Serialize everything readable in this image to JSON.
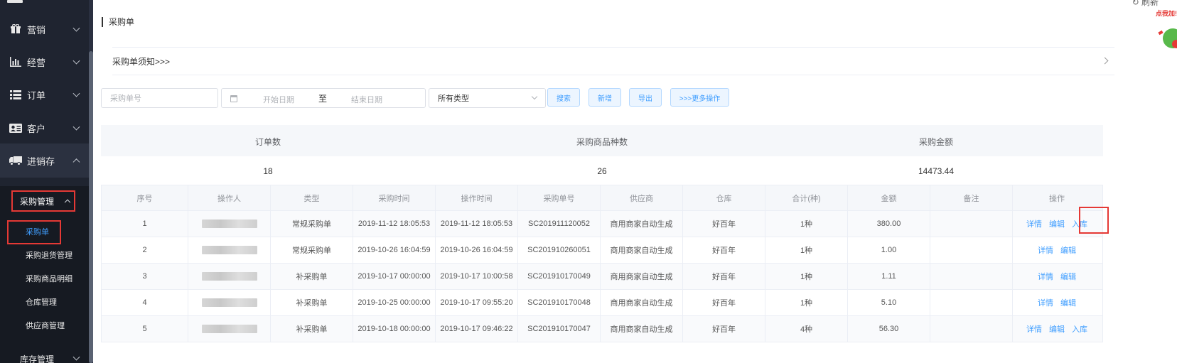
{
  "sidebar": {
    "items": [
      {
        "label": "营销",
        "icon": "gift-icon"
      },
      {
        "label": "经营",
        "icon": "bar-chart-icon"
      },
      {
        "label": "订单",
        "icon": "list-icon"
      },
      {
        "label": "客户",
        "icon": "id-card-icon"
      },
      {
        "label": "进销存",
        "icon": "truck-icon"
      }
    ],
    "sub_head": "采购管理",
    "sub_items": [
      "采购单",
      "采购退货管理",
      "采购商品明细",
      "仓库管理",
      "供应商管理"
    ],
    "partial_item": "库存管理"
  },
  "header": {
    "refresh_label": "刷新",
    "ad_tag": "点我加!"
  },
  "page": {
    "title": "采购单",
    "notice": "采购单须知>>>"
  },
  "filters": {
    "order_placeholder": "采购单号",
    "start_placeholder": "开始日期",
    "date_sep": "至",
    "end_placeholder": "结束日期",
    "type_selected": "所有类型",
    "buttons": [
      "搜索",
      "新增",
      "导出",
      ">>>更多操作"
    ]
  },
  "summary": {
    "headers": [
      "订单数",
      "采购商品种数",
      "采购金额"
    ],
    "values": [
      "18",
      "26",
      "14473.44"
    ]
  },
  "table": {
    "columns": [
      "序号",
      "操作人",
      "类型",
      "采购时间",
      "操作时间",
      "采购单号",
      "供应商",
      "仓库",
      "合计(种)",
      "金额",
      "备注",
      "操作"
    ],
    "rows": [
      {
        "no": "1",
        "type": "常规采购单",
        "purchase_time": "2019-11-12 18:05:53",
        "op_time": "2019-11-12 18:05:53",
        "order_no": "SC201911120052",
        "supplier": "商用商家自动生成",
        "warehouse": "好百年",
        "total": "1种",
        "amount": "380.00",
        "remark": "",
        "actions": [
          "详情",
          "编辑",
          "入库"
        ]
      },
      {
        "no": "2",
        "type": "常规采购单",
        "purchase_time": "2019-10-26 16:04:59",
        "op_time": "2019-10-26 16:04:59",
        "order_no": "SC201910260051",
        "supplier": "商用商家自动生成",
        "warehouse": "好百年",
        "total": "1种",
        "amount": "1.00",
        "remark": "",
        "actions": [
          "详情",
          "编辑"
        ]
      },
      {
        "no": "3",
        "type": "补采购单",
        "purchase_time": "2019-10-17 00:00:00",
        "op_time": "2019-10-17 10:00:58",
        "order_no": "SC201910170049",
        "supplier": "商用商家自动生成",
        "warehouse": "好百年",
        "total": "1种",
        "amount": "1.11",
        "remark": "",
        "actions": [
          "详情",
          "编辑"
        ]
      },
      {
        "no": "4",
        "type": "补采购单",
        "purchase_time": "2019-10-25 00:00:00",
        "op_time": "2019-10-17 09:55:20",
        "order_no": "SC201910170048",
        "supplier": "商用商家自动生成",
        "warehouse": "好百年",
        "total": "1种",
        "amount": "5.10",
        "remark": "",
        "actions": [
          "详情",
          "编辑"
        ]
      },
      {
        "no": "5",
        "type": "补采购单",
        "purchase_time": "2019-10-18 00:00:00",
        "op_time": "2019-10-17 09:46:22",
        "order_no": "SC201910170047",
        "supplier": "商用商家自动生成",
        "warehouse": "好百年",
        "total": "4种",
        "amount": "56.30",
        "remark": "",
        "actions": [
          "详情",
          "编辑",
          "入库"
        ]
      }
    ]
  },
  "colors": {
    "sidebar_bg": "#1f2430",
    "accent": "#409eff",
    "highlight": "#e53935"
  }
}
